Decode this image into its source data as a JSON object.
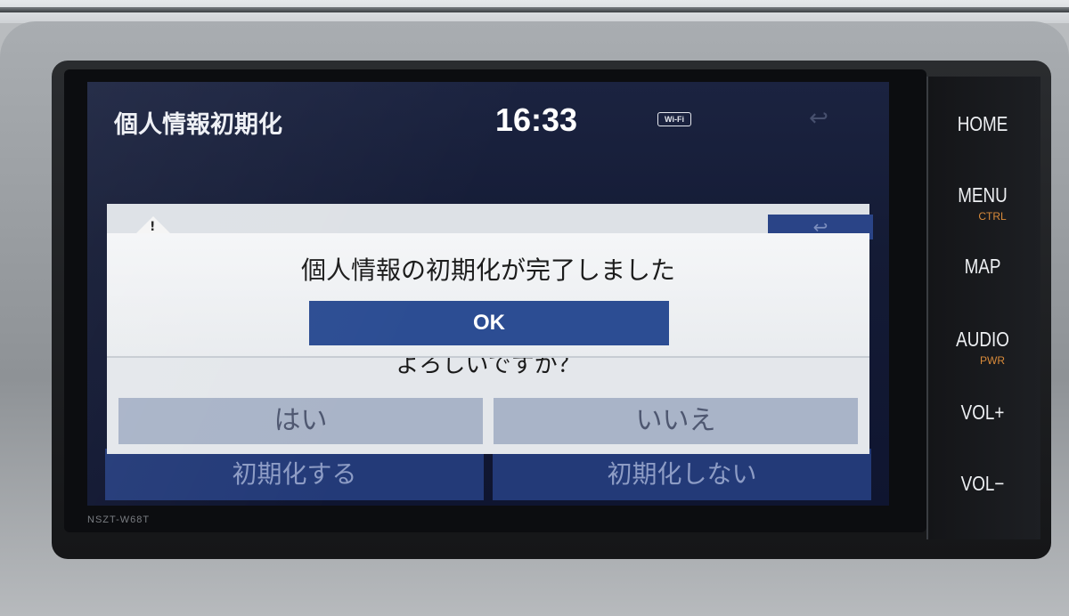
{
  "screen": {
    "page_title": "個人情報初期化",
    "clock": "16:33",
    "wifi_label": "Wi-Fi",
    "back_icon": "back-arrow-icon"
  },
  "dialog": {
    "message": "個人情報の初期化が完了しました",
    "ok_label": "OK",
    "question": "よろしいですか？",
    "yes_label": "はい",
    "no_label": "いいえ"
  },
  "underlying": {
    "init_label": "初期化する",
    "no_init_label": "初期化しない"
  },
  "hardware_buttons": {
    "home": "HOME",
    "menu": "MENU",
    "menu_sub": "CTRL",
    "map": "MAP",
    "audio": "AUDIO",
    "audio_sub": "PWR",
    "vol_up": "VOL+",
    "vol_down": "VOL−"
  },
  "model": "NSZT-W68T",
  "colors": {
    "accent": "#2c4d93",
    "button_sub": "#d88a3a",
    "screen_bg": "#141b35"
  }
}
